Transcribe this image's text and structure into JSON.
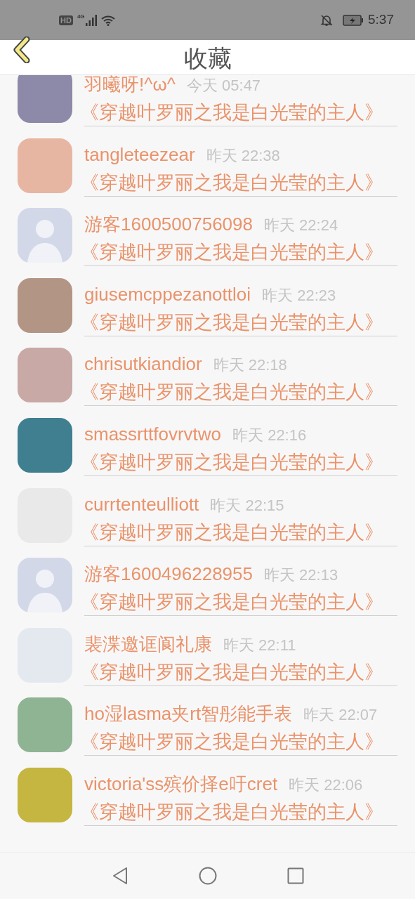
{
  "status_bar": {
    "hd": "HD",
    "network": "4G",
    "time": "5:37"
  },
  "header": {
    "title": "收藏"
  },
  "items": [
    {
      "name": "羽曦呀!^ω^",
      "time": "今天 05:47",
      "book": "《穿越叶罗丽之我是白光莹的主人》",
      "kind": "photo"
    },
    {
      "name": "tangleteezear",
      "time": "昨天 22:38",
      "book": "《穿越叶罗丽之我是白光莹的主人》",
      "kind": "photo"
    },
    {
      "name": "游客1600500756098",
      "time": "昨天 22:24",
      "book": "《穿越叶罗丽之我是白光莹的主人》",
      "kind": "default"
    },
    {
      "name": "giusemcppezanottloi",
      "time": "昨天 22:23",
      "book": "《穿越叶罗丽之我是白光莹的主人》",
      "kind": "photo"
    },
    {
      "name": "chrisutkiandior",
      "time": "昨天 22:18",
      "book": "《穿越叶罗丽之我是白光莹的主人》",
      "kind": "photo"
    },
    {
      "name": "smassrttfovrvtwo",
      "time": "昨天 22:16",
      "book": "《穿越叶罗丽之我是白光莹的主人》",
      "kind": "photo"
    },
    {
      "name": "currtenteulliott",
      "time": "昨天 22:15",
      "book": "《穿越叶罗丽之我是白光莹的主人》",
      "kind": "photo"
    },
    {
      "name": "游客1600496228955",
      "time": "昨天 22:13",
      "book": "《穿越叶罗丽之我是白光莹的主人》",
      "kind": "default"
    },
    {
      "name": "裴渫邀诓阆礼康",
      "time": "昨天 22:11",
      "book": "《穿越叶罗丽之我是白光莹的主人》",
      "kind": "photo"
    },
    {
      "name": "ho湿lasma夹rt智彤能手表",
      "time": "昨天 22:07",
      "book": "《穿越叶罗丽之我是白光莹的主人》",
      "kind": "photo"
    },
    {
      "name": "victoria'ss殡价择e吁cret",
      "time": "昨天 22:06",
      "book": "《穿越叶罗丽之我是白光莹的主人》",
      "kind": "photo"
    }
  ]
}
